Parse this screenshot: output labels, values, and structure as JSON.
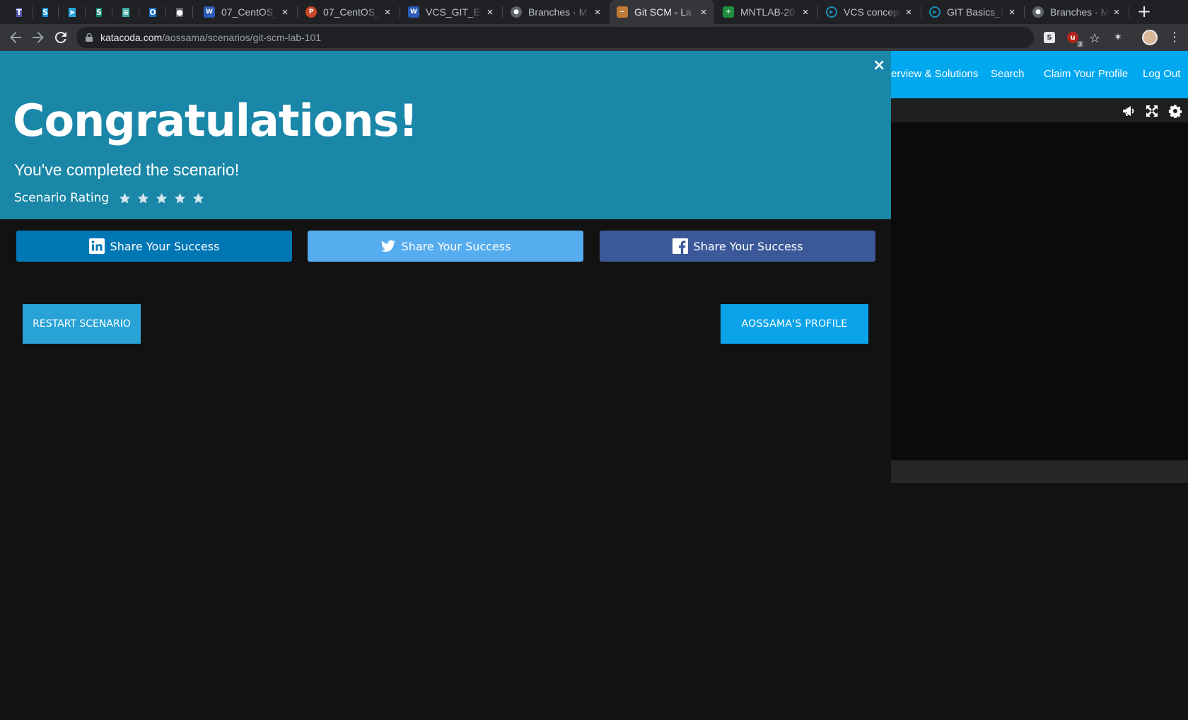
{
  "browser": {
    "pinned_tabs": [
      {
        "icon": "teams-icon",
        "glyph": "T",
        "color": "#5558af"
      },
      {
        "icon": "skype-icon",
        "glyph": "S",
        "color": "#0a8fd8"
      },
      {
        "icon": "telegram-icon",
        "glyph": "➤",
        "color": "#2aa3df"
      },
      {
        "icon": "sharepoint-icon",
        "glyph": "S",
        "color": "#108272"
      },
      {
        "icon": "chat-icon",
        "glyph": "≡",
        "color": "#3aa89f"
      },
      {
        "icon": "outlook-icon",
        "glyph": "O",
        "color": "#1470c8"
      },
      {
        "icon": "github-icon",
        "glyph": "●",
        "color": "#5f6368"
      }
    ],
    "tabs": [
      {
        "title": "07_CentOS_",
        "icon": "word-icon",
        "glyph": "W",
        "color": "#2b5db8"
      },
      {
        "title": "07_CentOS_",
        "icon": "powerpoint-icon",
        "glyph": "P",
        "color": "#c9472a"
      },
      {
        "title": "VCS_GIT_Es",
        "icon": "word-icon",
        "glyph": "W",
        "color": "#2b5db8"
      },
      {
        "title": "Branches · M",
        "icon": "github-icon",
        "glyph": "●",
        "color": "#5f6368"
      },
      {
        "title": "Git SCM - La",
        "icon": "katacoda-icon",
        "glyph": "~",
        "color": "#c07a35",
        "active": true
      },
      {
        "title": "MNTLAB-20",
        "icon": "sheets-icon",
        "glyph": "+",
        "color": "#1e8e3e"
      },
      {
        "title": "VCS concept",
        "icon": "play-circle-icon",
        "glyph": "▶",
        "color": "#1a8fb2"
      },
      {
        "title": "GIT Basics_F",
        "icon": "play-circle-icon",
        "glyph": "▶",
        "color": "#1a8fb2"
      },
      {
        "title": "Branches · M",
        "icon": "github-icon",
        "glyph": "●",
        "color": "#5f6368"
      }
    ],
    "close_glyph": "×",
    "new_tab_glyph": "+",
    "url_host": "katacoda.com",
    "url_path": "/aossama/scenarios/git-scm-lab-101",
    "extension_badge": "3"
  },
  "site_nav": {
    "links": [
      "erview & Solutions",
      "Search",
      "Claim Your Profile",
      "Log Out"
    ]
  },
  "modal": {
    "close_glyph": "×",
    "headline": "Congratulations!",
    "subline": "You've completed the scenario!",
    "rating_label": "Scenario Rating",
    "rating_stars": 5,
    "share": [
      {
        "network": "linkedin",
        "label": "Share Your Success",
        "color": "#0077b5"
      },
      {
        "network": "twitter",
        "label": "Share Your Success",
        "color": "#55acee"
      },
      {
        "network": "facebook",
        "label": "Share Your Success",
        "color": "#3b5998"
      }
    ],
    "restart_label": "RESTART SCENARIO",
    "profile_label": "AOSSAMA'S PROFILE"
  }
}
